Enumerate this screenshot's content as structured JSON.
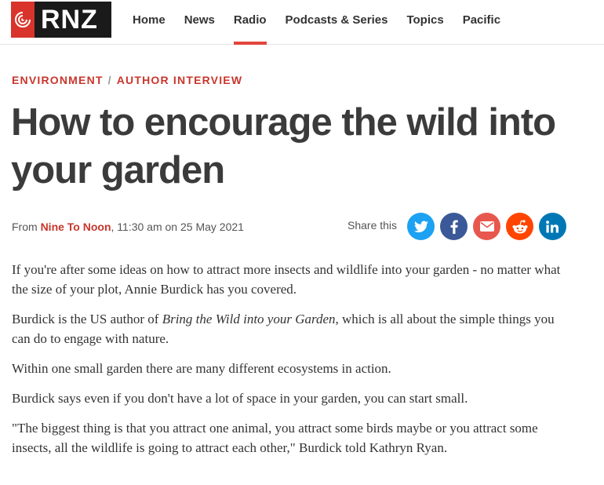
{
  "site": {
    "logo_text": "RNZ",
    "nav": [
      {
        "label": "Home"
      },
      {
        "label": "News"
      },
      {
        "label": "Radio",
        "active": true
      },
      {
        "label": "Podcasts & Series"
      },
      {
        "label": "Topics"
      },
      {
        "label": "Pacific"
      }
    ]
  },
  "article": {
    "breadcrumb": [
      "Environment",
      "Author Interview"
    ],
    "title": "How to encourage the wild into your garden",
    "meta": {
      "from_label": "From",
      "program": "Nine To Noon",
      "datetime": ", 11:30 am on 25 May 2021"
    },
    "share": {
      "label": "Share this",
      "buttons": [
        {
          "name": "twitter",
          "icon": "twitter-icon",
          "color": "#1da1f2"
        },
        {
          "name": "facebook",
          "icon": "facebook-icon",
          "color": "#3b5998"
        },
        {
          "name": "email",
          "icon": "email-icon",
          "color": "#e8574d"
        },
        {
          "name": "reddit",
          "icon": "reddit-icon",
          "color": "#ff4500"
        },
        {
          "name": "linkedin",
          "icon": "linkedin-icon",
          "color": "#0077b5"
        }
      ]
    },
    "body": {
      "p1": "If you're after some ideas on how to attract more insects and wildlife into your garden - no matter what the size of your plot, Annie Burdick has you covered.",
      "p2_before": "Burdick is the US author of ",
      "p2_book": "Bring the Wild into your Garden",
      "p2_after": ", which is all about the simple things you can do to engage with nature.",
      "p3": "Within one small garden there are many different ecosystems in action.",
      "p4": "Burdick says even if you don't have a lot of space in your garden, you can start small.",
      "p5": "\"The biggest thing is that you attract one animal, you attract some birds maybe or you attract some insects, all the wildlife is going to attract each other,\" Burdick told Kathryn Ryan."
    }
  }
}
